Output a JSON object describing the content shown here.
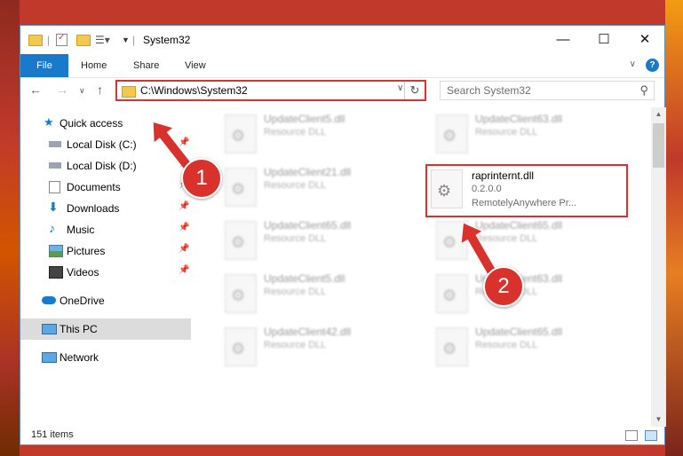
{
  "window": {
    "title": "System32",
    "minimize": "—",
    "maximize": "☐",
    "close": "✕"
  },
  "ribbon": {
    "tabs": [
      "File",
      "Home",
      "Share",
      "View"
    ],
    "help": "?"
  },
  "address": {
    "path": "C:\\Windows\\System32"
  },
  "search": {
    "placeholder": "Search System32"
  },
  "nav_pane": {
    "quick_access": "Quick access",
    "items": [
      {
        "label": "Local Disk (C:)",
        "icon": "drive-icon",
        "pinned": true
      },
      {
        "label": "Local Disk (D:)",
        "icon": "drive-icon",
        "pinned": true
      },
      {
        "label": "Documents",
        "icon": "documents-icon",
        "pinned": true
      },
      {
        "label": "Downloads",
        "icon": "downloads-icon",
        "pinned": true
      },
      {
        "label": "Music",
        "icon": "music-icon",
        "pinned": true
      },
      {
        "label": "Pictures",
        "icon": "pictures-icon",
        "pinned": true
      },
      {
        "label": "Videos",
        "icon": "videos-icon",
        "pinned": true
      }
    ],
    "onedrive": "OneDrive",
    "this_pc": "This PC",
    "network": "Network"
  },
  "files": [
    {
      "name": "UpdateClient5.dll",
      "type": "Resource DLL"
    },
    {
      "name": "UpdateClient63.dll",
      "type": "Resource DLL"
    },
    {
      "name": "UpdateClient21.dll",
      "type": "Resource DLL"
    },
    {
      "name": "raprinternt.dll",
      "version": "0.2.0.0",
      "company": "RemotelyAnywhere Pr..."
    },
    {
      "name": "UpdateClient65.dll",
      "type": "Resource DLL"
    },
    {
      "name": "UpdateClient65.dll",
      "type": "Resource DLL"
    },
    {
      "name": "UpdateClient5.dll",
      "type": "Resource DLL"
    },
    {
      "name": "UpdateClient63.dll",
      "type": "Resource DLL"
    },
    {
      "name": "UpdateClient42.dll",
      "type": "Resource DLL"
    },
    {
      "name": "UpdateClient65.dll",
      "type": "Resource DLL"
    }
  ],
  "status": {
    "items": "151 items"
  },
  "annotations": {
    "step1": "1",
    "step2": "2",
    "color": "#d9312b"
  }
}
